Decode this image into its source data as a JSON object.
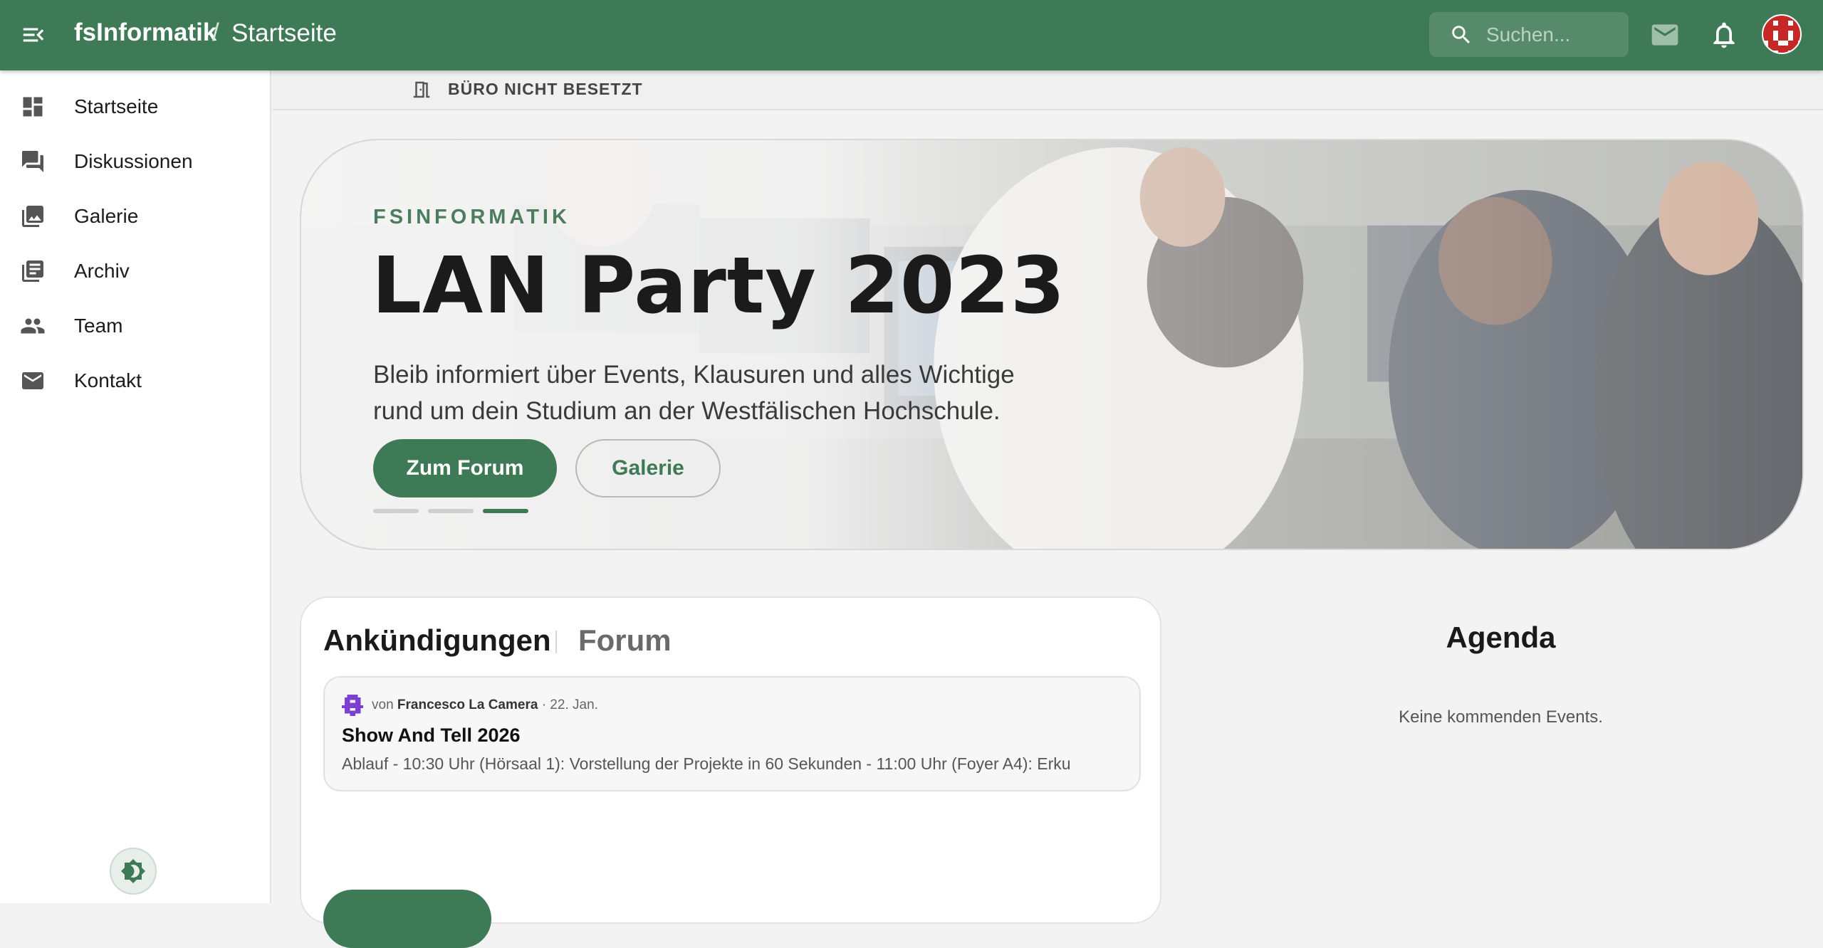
{
  "header": {
    "brand": "fsInformatik",
    "separator": "/",
    "current_page": "Startseite",
    "search_placeholder": "Suchen..."
  },
  "sidebar": {
    "items": [
      {
        "label": "Startseite",
        "icon": "dashboard-icon"
      },
      {
        "label": "Diskussionen",
        "icon": "forum-icon"
      },
      {
        "label": "Galerie",
        "icon": "gallery-icon"
      },
      {
        "label": "Archiv",
        "icon": "archive-icon"
      },
      {
        "label": "Team",
        "icon": "team-icon"
      },
      {
        "label": "Kontakt",
        "icon": "mail-icon"
      }
    ]
  },
  "status": {
    "text": "BÜRO NICHT BESETZT",
    "icon": "door-icon"
  },
  "hero": {
    "kicker": "FSINFORMATIK",
    "title": "LAN Party 2023",
    "description": "Bleib informiert über Events, Klausuren und alles Wichtige rund um dein Studium an der Westfälischen Hochschule.",
    "primary_button": "Zum Forum",
    "secondary_button": "Galerie",
    "slides_total": 3,
    "active_slide": 3
  },
  "announcements": {
    "tabs": [
      "Ankündigungen",
      "Forum"
    ],
    "active_tab": "Ankündigungen",
    "posts": [
      {
        "prefix": "von",
        "author": "Francesco La Camera",
        "date": "· 22. Jan.",
        "title": "Show And Tell 2026",
        "excerpt": "Ablauf - 10:30 Uhr (Hörsaal 1): Vorstellung der Projekte in 60 Sekunden - 11:00 Uhr (Foyer A4): Erku"
      }
    ]
  },
  "agenda": {
    "title": "Agenda",
    "empty_text": "Keine kommenden Events."
  },
  "colors": {
    "primary": "#3f7a57",
    "background": "#f3f3f3",
    "surface": "#ffffff"
  }
}
